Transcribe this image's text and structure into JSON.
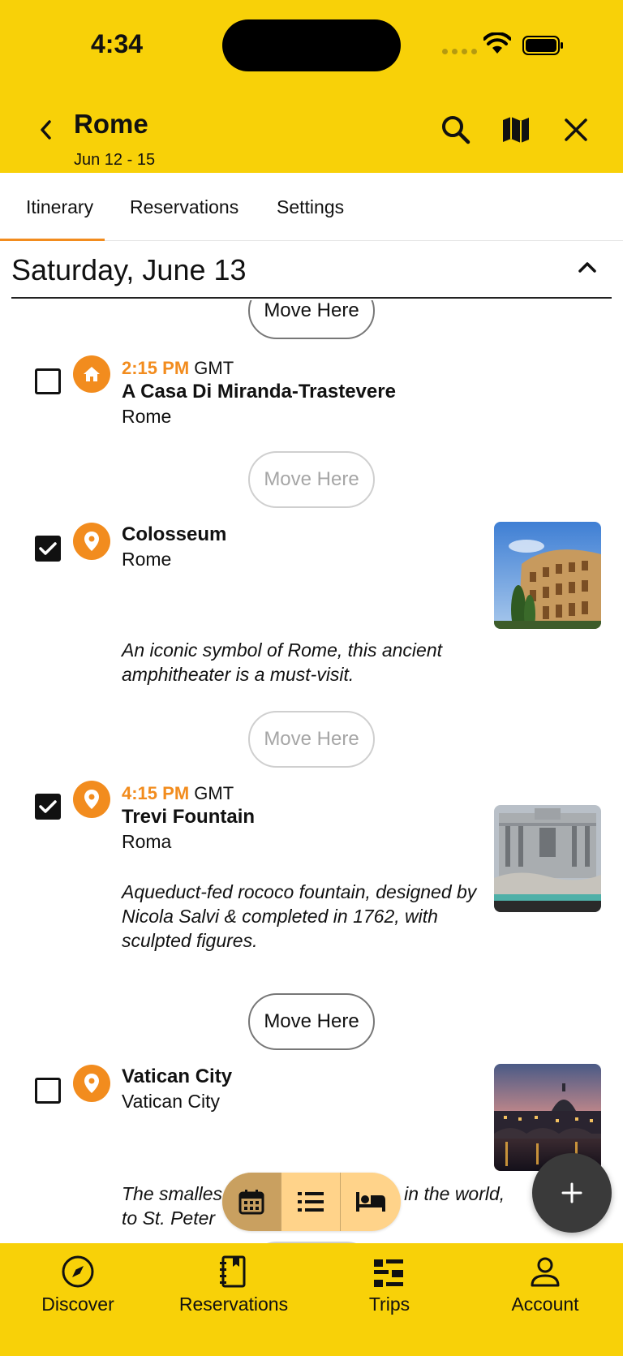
{
  "status": {
    "time": "4:34"
  },
  "header": {
    "title": "Rome",
    "dates": "Jun 12 - 15",
    "icons": [
      "chevron-left-icon",
      "search-icon",
      "map-icon",
      "close-icon"
    ]
  },
  "tabs": [
    {
      "label": "Itinerary",
      "active": true
    },
    {
      "label": "Reservations",
      "active": false
    },
    {
      "label": "Settings",
      "active": false
    }
  ],
  "day": {
    "title": "Saturday, June 13"
  },
  "move_label": "Move Here",
  "items": [
    {
      "checked": false,
      "icon": "home-icon",
      "time": "2:15 PM",
      "tz": "GMT",
      "title": "A Casa Di Miranda-Trastevere",
      "subtitle": "Rome"
    },
    {
      "checked": true,
      "icon": "location-pin-icon",
      "title": "Colosseum",
      "subtitle": "Rome",
      "description": "An iconic symbol of Rome, this ancient amphitheater is a must-visit."
    },
    {
      "checked": true,
      "icon": "location-pin-icon",
      "time": "4:15 PM",
      "tz": "GMT",
      "title": "Trevi Fountain",
      "subtitle": "Roma",
      "description": "Aqueduct-fed rococo fountain, designed by Nicola Salvi & completed in 1762, with sculpted figures."
    },
    {
      "checked": false,
      "icon": "location-pin-icon",
      "title": "Vatican City",
      "subtitle": "Vatican City",
      "description_line1": "The smalles",
      "description_line1b": "e in the world,",
      "description_line2": "to St. Peter"
    }
  ],
  "view_switch": [
    "calendar-icon",
    "list-icon",
    "bed-icon"
  ],
  "fab_icon": "plus-icon",
  "bottom_nav": [
    {
      "label": "Discover",
      "icon": "compass-icon"
    },
    {
      "label": "Reservations",
      "icon": "notebook-icon"
    },
    {
      "label": "Trips",
      "icon": "trips-list-icon"
    },
    {
      "label": "Account",
      "icon": "person-icon"
    }
  ],
  "colors": {
    "header_bg": "#F8D108",
    "accent": "#F28C1E",
    "fab_bg": "#3a3a3a"
  }
}
